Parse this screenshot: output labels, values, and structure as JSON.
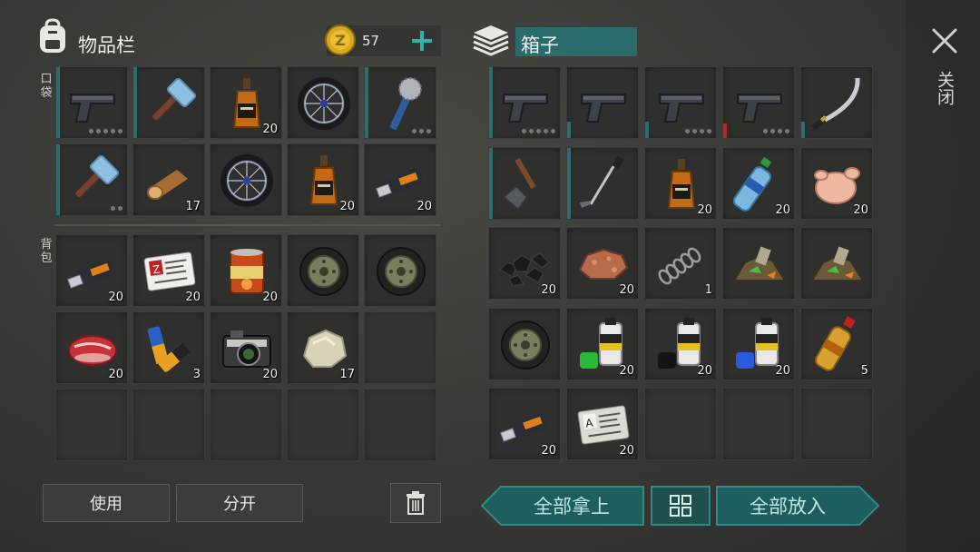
{
  "inventory": {
    "title": "物品栏",
    "coins": "57",
    "pocket_label": "口袋",
    "backpack_label": "背包",
    "pocket_slots": [
      {
        "icon": "pistol-icon",
        "dots": 5,
        "bar": "full",
        "count": ""
      },
      {
        "icon": "sledgehammer-icon",
        "dots": 0,
        "bar": "full",
        "count": ""
      },
      {
        "icon": "whiskey-bottle-icon",
        "dots": 0,
        "bar": "none",
        "count": "20"
      },
      {
        "icon": "wheel-icon",
        "dots": 0,
        "bar": "none",
        "count": ""
      },
      {
        "icon": "saw-club-icon",
        "dots": 3,
        "bar": "full",
        "count": ""
      },
      {
        "icon": "sledgehammer-icon",
        "dots": 2,
        "bar": "full",
        "count": ""
      },
      {
        "icon": "log-icon",
        "dots": 0,
        "bar": "none",
        "count": "17"
      },
      {
        "icon": "wheel-icon",
        "dots": 0,
        "bar": "none",
        "count": ""
      },
      {
        "icon": "whiskey-bottle-icon",
        "dots": 0,
        "bar": "none",
        "count": "20"
      },
      {
        "icon": "usb-drive-icon",
        "dots": 0,
        "bar": "none",
        "count": "20"
      }
    ],
    "backpack_slots": [
      {
        "icon": "usb-drive-icon",
        "count": "20"
      },
      {
        "icon": "army-id-card-z-icon",
        "count": "20"
      },
      {
        "icon": "food-can-icon",
        "count": "20"
      },
      {
        "icon": "tire-icon",
        "count": ""
      },
      {
        "icon": "tire-icon",
        "count": ""
      },
      {
        "icon": "raw-meat-icon",
        "count": "20"
      },
      {
        "icon": "batteries-icon",
        "count": "3"
      },
      {
        "icon": "camera-icon",
        "count": "20"
      },
      {
        "icon": "stone-icon",
        "count": "17"
      },
      {
        "icon": "",
        "count": ""
      },
      {
        "icon": "",
        "count": ""
      },
      {
        "icon": "",
        "count": ""
      },
      {
        "icon": "",
        "count": ""
      },
      {
        "icon": "",
        "count": ""
      },
      {
        "icon": "",
        "count": ""
      }
    ],
    "use_label": "使用",
    "split_label": "分开"
  },
  "box": {
    "title": "箱子",
    "slots": [
      {
        "icon": "pistol-icon",
        "dots": 5,
        "bar": "full",
        "count": ""
      },
      {
        "icon": "pistol-icon",
        "dots": 0,
        "bar": "low",
        "count": ""
      },
      {
        "icon": "pistol-icon",
        "dots": 4,
        "bar": "low",
        "count": ""
      },
      {
        "icon": "pistol-icon",
        "dots": 4,
        "bar": "red",
        "count": ""
      },
      {
        "icon": "katana-icon",
        "dots": 0,
        "bar": "low",
        "count": ""
      },
      {
        "icon": "shovel-icon",
        "dots": 0,
        "bar": "full",
        "count": ""
      },
      {
        "icon": "golf-club-icon",
        "dots": 0,
        "bar": "full",
        "count": ""
      },
      {
        "icon": "whiskey-bottle-icon",
        "dots": 0,
        "bar": "none",
        "count": "20"
      },
      {
        "icon": "water-bottle-icon",
        "dots": 0,
        "bar": "none",
        "count": "20"
      },
      {
        "icon": "raw-chicken-icon",
        "dots": 0,
        "bar": "none",
        "count": "20"
      },
      {
        "icon": "coal-icon",
        "dots": 0,
        "bar": "none",
        "count": "20"
      },
      {
        "icon": "iron-ore-icon",
        "dots": 0,
        "bar": "none",
        "count": "20"
      },
      {
        "icon": "spring-icon",
        "dots": 0,
        "bar": "none",
        "count": "1"
      },
      {
        "icon": "scrap-pile-icon",
        "dots": 0,
        "bar": "none",
        "count": ""
      },
      {
        "icon": "scrap-pile-icon",
        "dots": 0,
        "bar": "none",
        "count": ""
      },
      {
        "icon": "tire-icon",
        "dots": 0,
        "bar": "none",
        "count": ""
      },
      {
        "icon": "paint-green-icon",
        "dots": 0,
        "bar": "none",
        "count": "20"
      },
      {
        "icon": "paint-black-icon",
        "dots": 0,
        "bar": "none",
        "count": "20"
      },
      {
        "icon": "paint-blue-icon",
        "dots": 0,
        "bar": "none",
        "count": "20"
      },
      {
        "icon": "gasoline-bottle-icon",
        "dots": 0,
        "bar": "none",
        "count": "5"
      },
      {
        "icon": "usb-drive-icon",
        "dots": 0,
        "bar": "none",
        "count": "20"
      },
      {
        "icon": "army-id-card-a-icon",
        "dots": 0,
        "bar": "none",
        "count": "20"
      },
      {
        "icon": "",
        "dots": 0,
        "bar": "none",
        "count": ""
      },
      {
        "icon": "",
        "dots": 0,
        "bar": "none",
        "count": ""
      },
      {
        "icon": "",
        "dots": 0,
        "bar": "none",
        "count": ""
      }
    ],
    "take_all_label": "全部拿上",
    "put_all_label": "全部放入"
  },
  "close_label": "关闭",
  "colors": {
    "accent": "#1f5e5e",
    "bar": "#2a6f6f",
    "danger": "#b22222"
  }
}
